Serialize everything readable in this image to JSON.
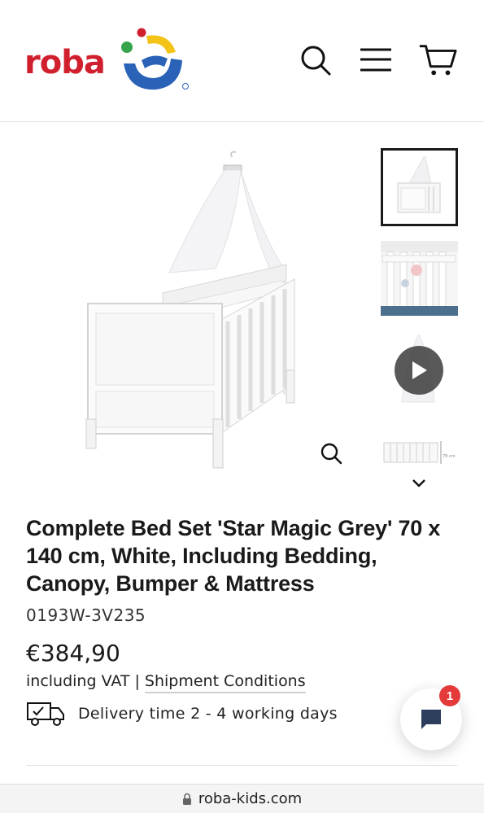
{
  "brand": {
    "name": "roba",
    "colors": {
      "logo_red": "#d0202e",
      "logo_blue": "#2a62b8",
      "logo_yellow": "#f3c318",
      "logo_green": "#36a44a"
    }
  },
  "header": {
    "icons": [
      "search-icon",
      "menu-icon",
      "cart-icon"
    ]
  },
  "gallery": {
    "thumbnails": [
      {
        "kind": "image",
        "active": true
      },
      {
        "kind": "image",
        "active": false
      },
      {
        "kind": "video",
        "active": false
      },
      {
        "kind": "image",
        "active": false,
        "caption": "78 cm"
      }
    ]
  },
  "product": {
    "title": "Complete Bed Set 'Star Magic Grey' 70 x 140 cm, White, Including Bedding, Canopy, Bumper & Mattress",
    "sku": "0193W-3V235",
    "price": "€384,90",
    "vat_text": "including VAT",
    "separator": "|",
    "shipment_link": "Shipment Conditions",
    "delivery_text": "Delivery time 2 - 4 working days"
  },
  "chat": {
    "badge_count": "1"
  },
  "browser": {
    "url": "roba-kids.com"
  }
}
